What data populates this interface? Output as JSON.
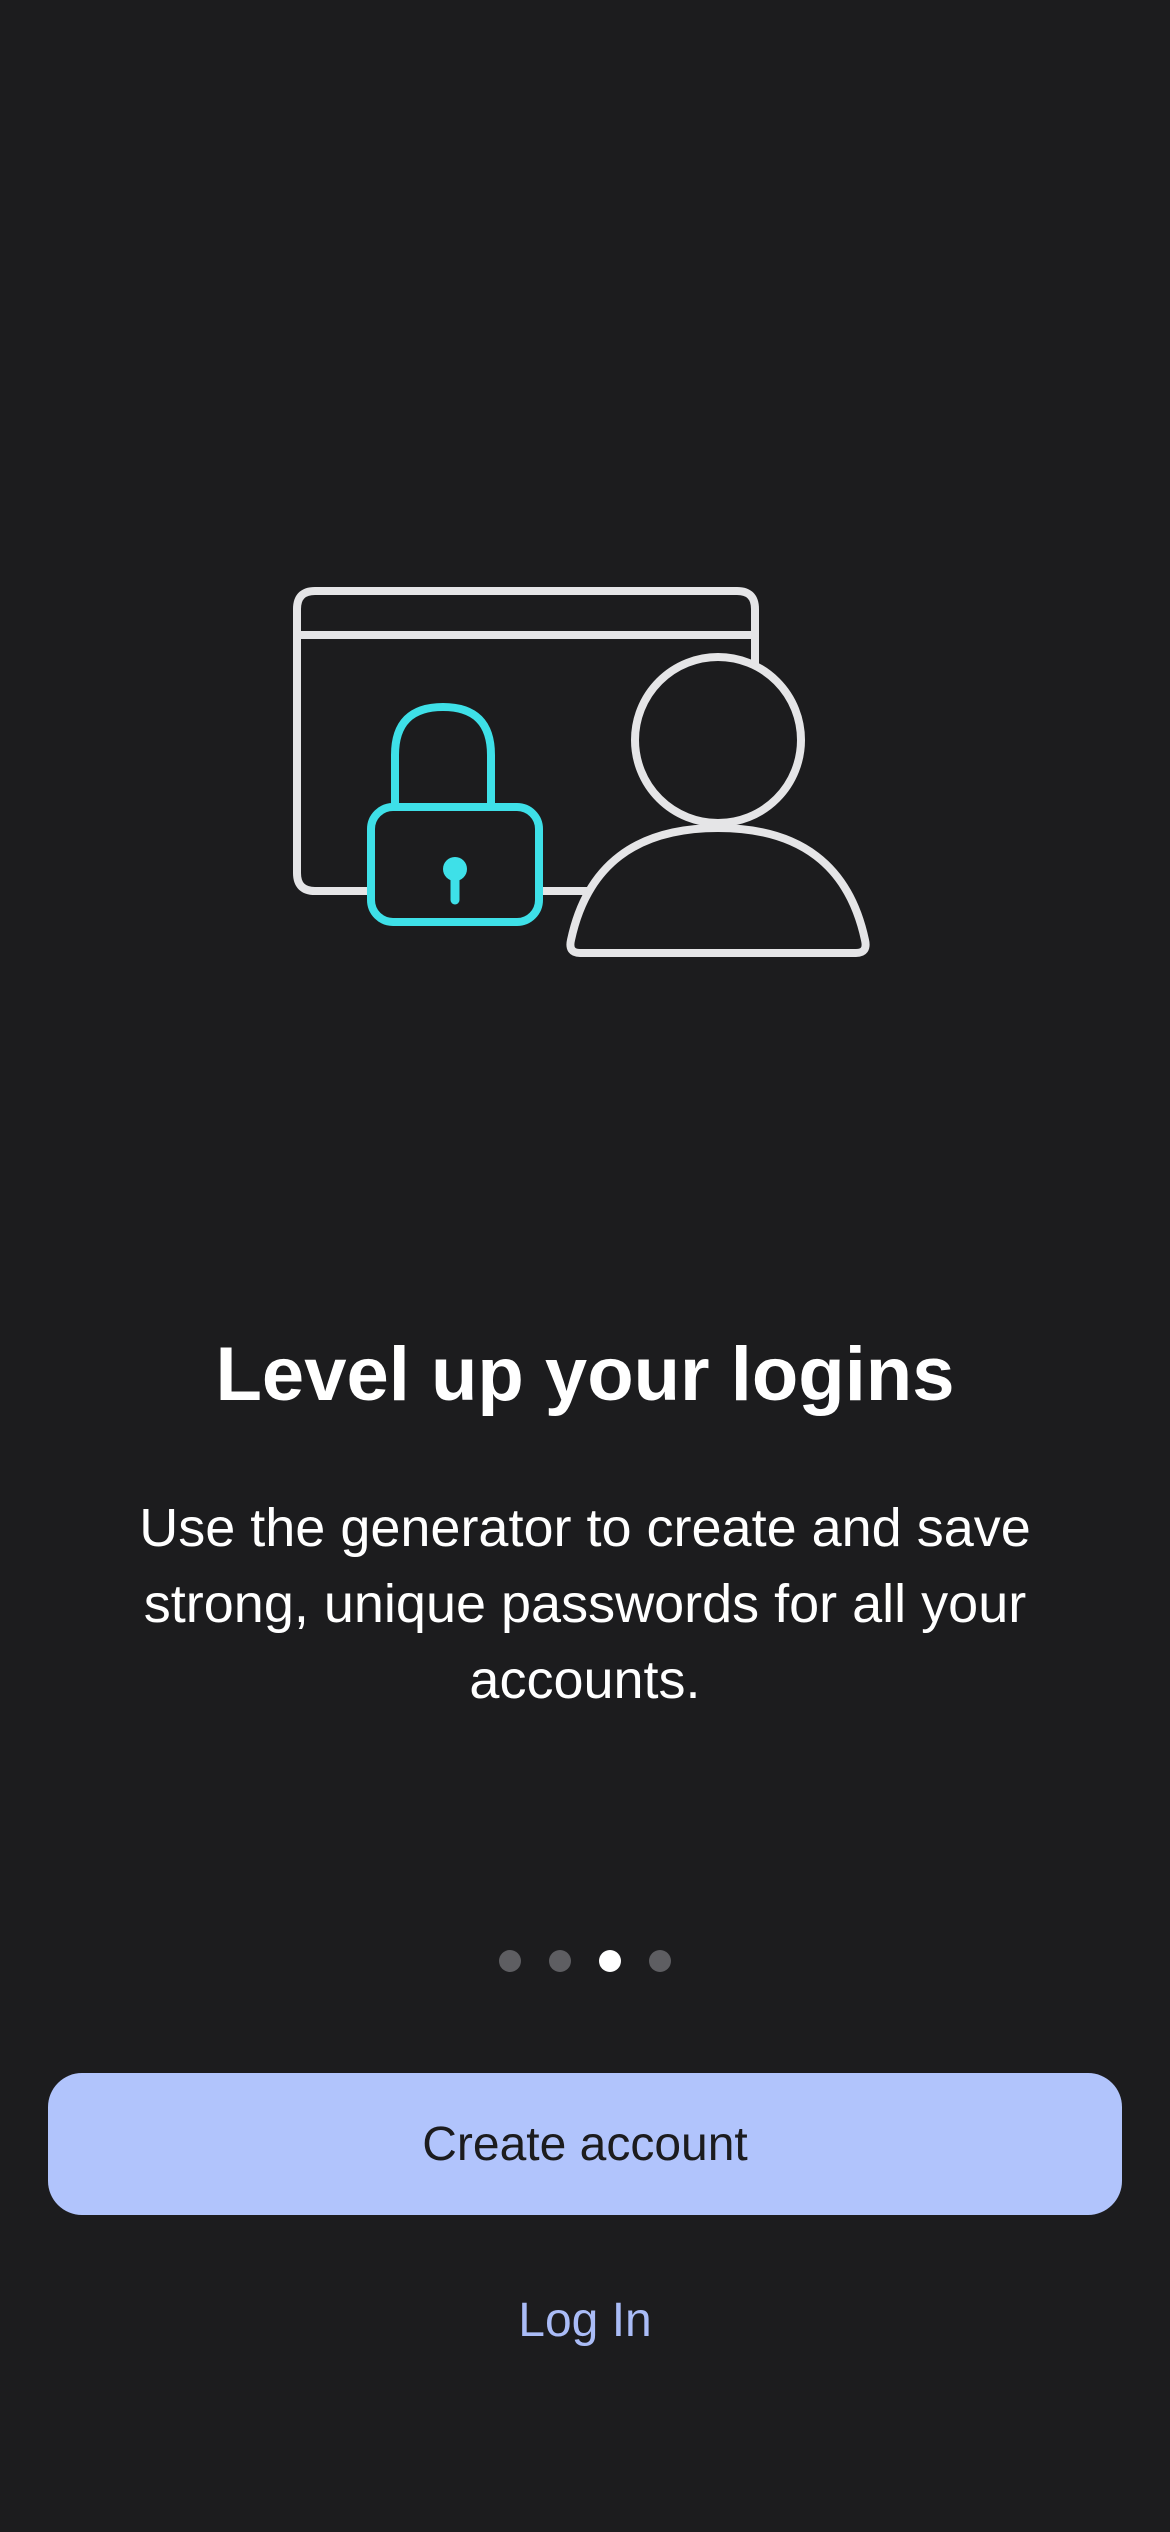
{
  "onboarding": {
    "title": "Level up your logins",
    "description": "Use the generator to create and save strong, unique passwords for all your accounts.",
    "page_indicator": {
      "total": 4,
      "current": 3
    }
  },
  "actions": {
    "create_account_label": "Create account",
    "log_in_label": "Log In"
  },
  "illustration": {
    "icons": [
      "browser-window-icon",
      "padlock-icon",
      "user-icon"
    ]
  },
  "colors": {
    "background": "#1c1c1e",
    "primary_button": "#b1c4fc",
    "link": "#aabcf7",
    "accent_lock": "#3ee0e8",
    "illustration_stroke": "#e5e5e7",
    "dot_inactive": "#5e5e62",
    "dot_active": "#ffffff"
  }
}
